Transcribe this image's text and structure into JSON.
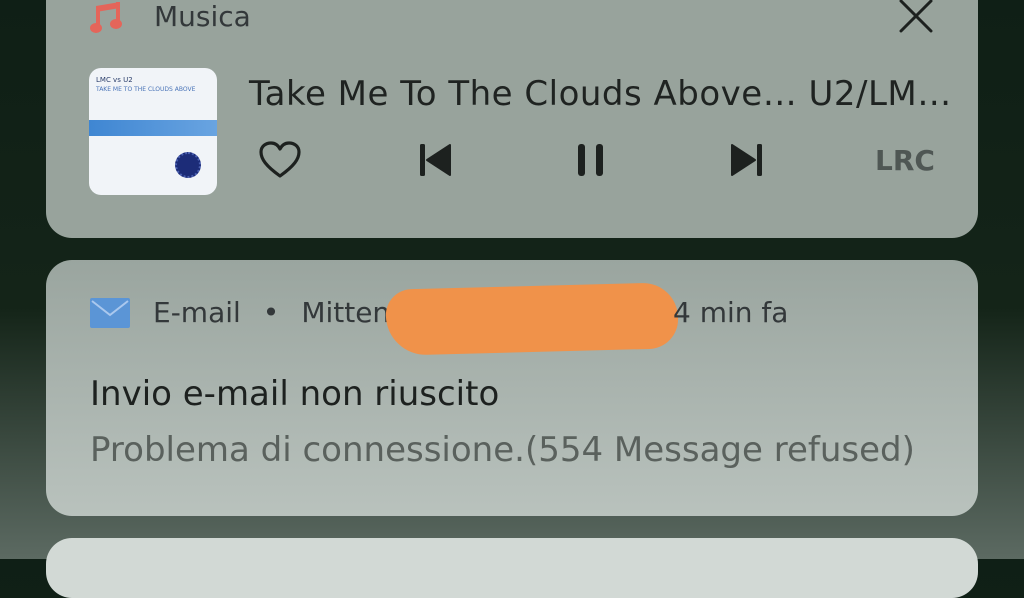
{
  "music": {
    "app_name": "Musica",
    "track": "Take Me To The Clouds Above… U2/LM…",
    "lrc_label": "LRC",
    "album_art": {
      "line1": "LMC vs U2",
      "line2": "TAKE ME TO THE CLOUDS ABOVE"
    },
    "icons": {
      "app": "music-note-icon",
      "close": "close-icon",
      "like": "heart-icon",
      "prev": "skip-previous-icon",
      "pause": "pause-icon",
      "next": "skip-next-icon"
    },
    "accent_color": "#e4655a"
  },
  "email": {
    "app_name": "E-mail",
    "separator": "•",
    "sender_label": "Mittent",
    "time": "4 min fa",
    "title": "Invio e-mail non riuscito",
    "body": "Problema di connessione.(554 Message refused)",
    "icons": {
      "app": "mail-icon"
    },
    "accent_color": "#5b95d6",
    "redaction_color": "#f0924a"
  }
}
